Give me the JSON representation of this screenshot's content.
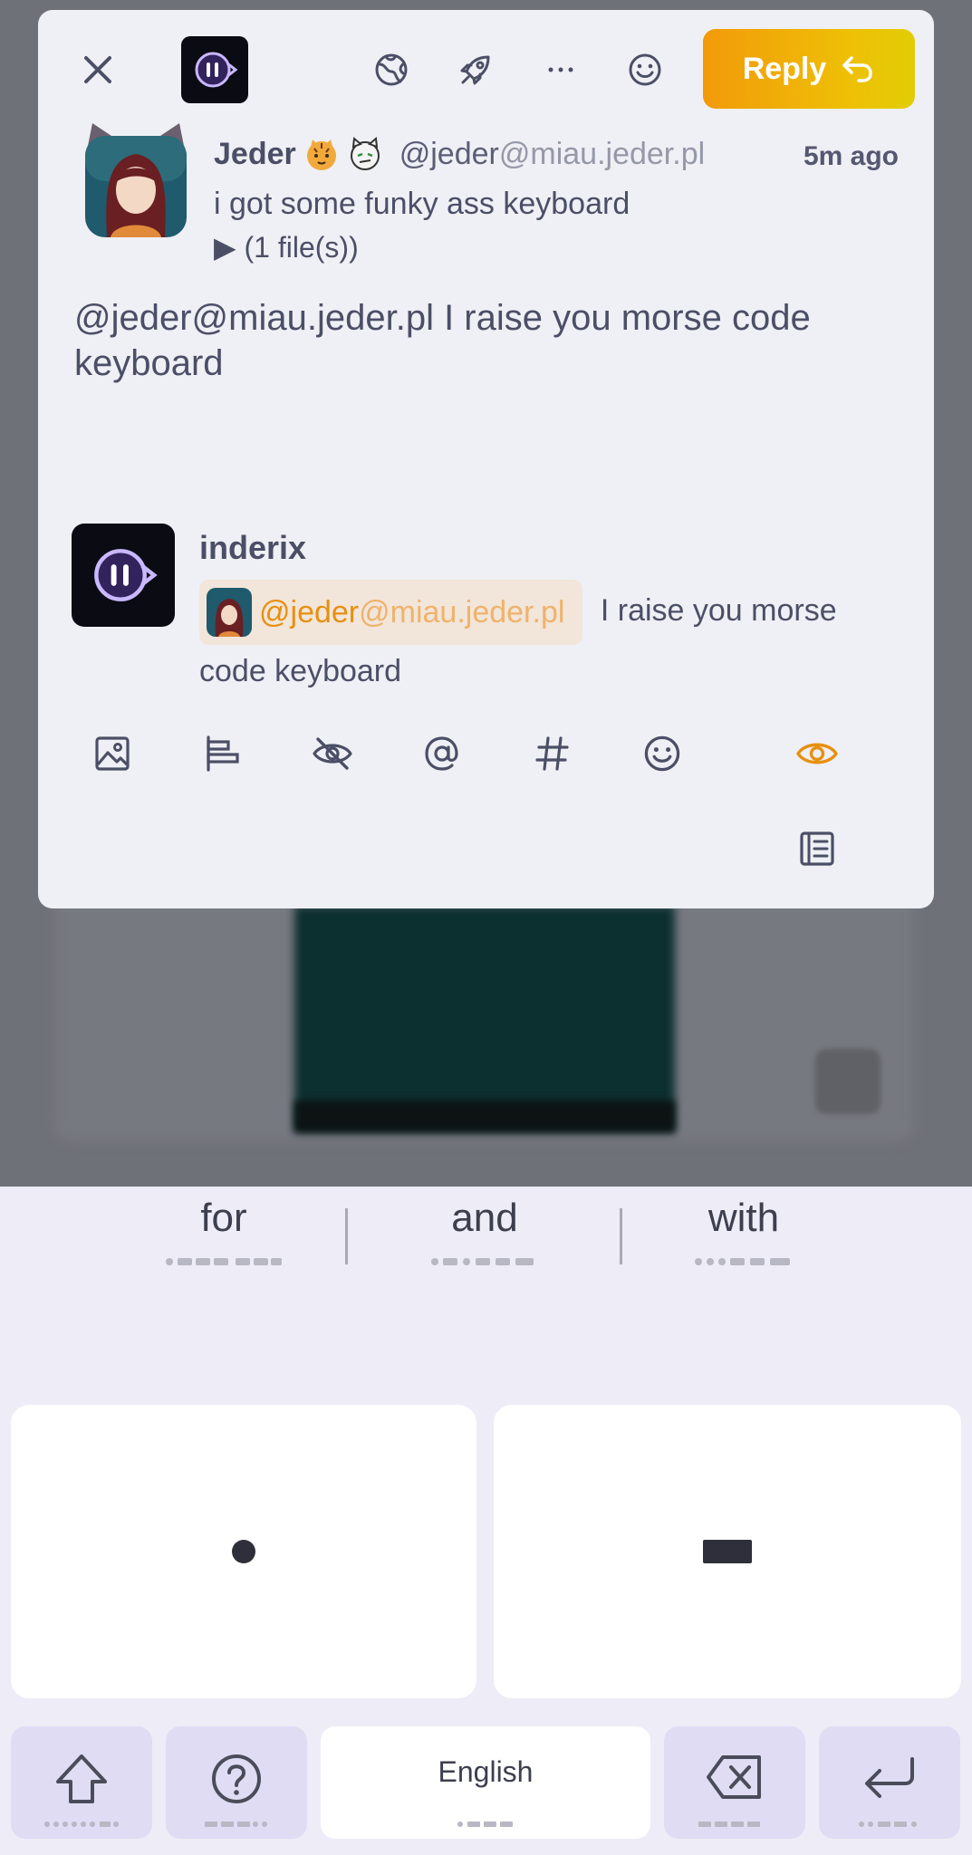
{
  "compose": {
    "reply_label": "Reply",
    "quoted": {
      "name": "Jeder",
      "handle_user": "@jeder",
      "handle_host": "@miau.jeder.pl",
      "time": "5m ago",
      "text": "i got some funky ass keyboard",
      "files": "▶ (1 file(s))"
    },
    "text": "@jeder@miau.jeder.pl I raise you morse code keyboard",
    "preview": {
      "author": "inderix",
      "mention_user": "@jeder",
      "mention_host": "@miau.jeder.pl",
      "text_rest": " I raise you morse code keyboard"
    },
    "icons": [
      "close-icon",
      "account-icon",
      "globe-icon",
      "rocket-icon",
      "more-icon",
      "emoji-icon",
      "reply-icon",
      "image-icon",
      "poll-icon",
      "hide-icon",
      "mention-icon",
      "hashtag-icon",
      "emoji-icon",
      "preview-eye-icon",
      "draft-list-icon"
    ],
    "colors": {
      "accent": "#e7900f",
      "reply_gradient_start": "#f29a0a",
      "reply_gradient_end": "#e2cd06",
      "text": "#4b4f66",
      "dialog_bg": "#eff0f5"
    }
  },
  "keyboard": {
    "suggestions": [
      "for",
      "and",
      "with"
    ],
    "language": "English",
    "keys": [
      "dot",
      "dash",
      "shift",
      "help",
      "space",
      "backspace",
      "enter"
    ]
  }
}
